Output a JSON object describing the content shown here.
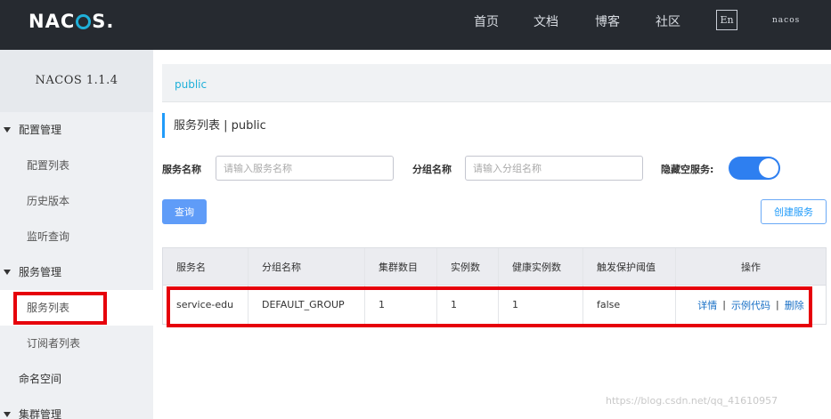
{
  "header": {
    "logo": "NACOS.",
    "nav": [
      "首页",
      "文档",
      "博客",
      "社区"
    ],
    "lang": "En",
    "user": "nacos"
  },
  "sidebar": {
    "title": "NACOS 1.1.4",
    "items": [
      {
        "label": "配置管理",
        "type": "group"
      },
      {
        "label": "配置列表",
        "type": "sub"
      },
      {
        "label": "历史版本",
        "type": "sub"
      },
      {
        "label": "监听查询",
        "type": "sub"
      },
      {
        "label": "服务管理",
        "type": "group"
      },
      {
        "label": "服务列表",
        "type": "sub",
        "active": true
      },
      {
        "label": "订阅者列表",
        "type": "sub"
      },
      {
        "label": "命名空间",
        "type": "plain"
      },
      {
        "label": "集群管理",
        "type": "group"
      }
    ]
  },
  "main": {
    "breadcrumb": "public",
    "heading": "服务列表 | public",
    "filters": {
      "service_label": "服务名称",
      "service_placeholder": "请输入服务名称",
      "group_label": "分组名称",
      "group_placeholder": "请输入分组名称",
      "hide_empty_label": "隐藏空服务:"
    },
    "query_button": "查询",
    "create_button": "创建服务",
    "table": {
      "headers": [
        "服务名",
        "分组名称",
        "集群数目",
        "实例数",
        "健康实例数",
        "触发保护阈值",
        "操作"
      ],
      "rows": [
        {
          "cells": [
            "service-edu",
            "DEFAULT_GROUP",
            "1",
            "1",
            "1",
            "false"
          ],
          "ops": [
            "详情",
            "示例代码",
            "删除"
          ]
        }
      ]
    }
  },
  "watermark": "https://blog.csdn.net/qq_41610957",
  "colors": {
    "topbar": "#262a30",
    "accent": "#209bfa",
    "highlight": "#e6000b"
  }
}
